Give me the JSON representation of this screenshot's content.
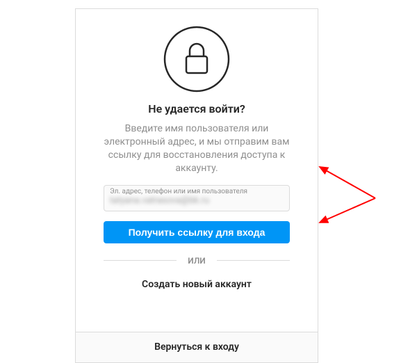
{
  "heading": "Не удается войти?",
  "description": "Введите имя пользователя или электронный адрес, и мы отправим вам ссылку для восстановления доступа к аккаунту.",
  "input": {
    "label": "Эл. адрес, телефон или имя пользователя",
    "value": "tatyana.vatrasova@bk.ru"
  },
  "submit_label": "Получить ссылку для входа",
  "divider_label": "ИЛИ",
  "create_account_label": "Создать новый аккаунт",
  "back_label": "Вернуться к входу"
}
